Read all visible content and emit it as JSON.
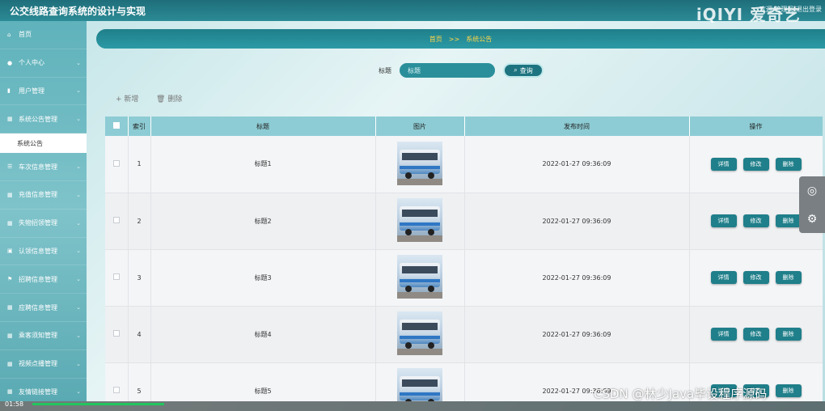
{
  "app": {
    "title": "公交线路查询系统的设计与实现",
    "top_right": "欢迎 管理员 退出登录",
    "brand_watermark": "iQIYI 爱奇艺"
  },
  "sidebar": {
    "items": [
      {
        "label": "首页",
        "icon": "home-icon",
        "glyph": "⌂"
      },
      {
        "label": "个人中心",
        "icon": "user-icon",
        "glyph": "●"
      },
      {
        "label": "用户管理",
        "icon": "bar-chart-icon",
        "glyph": "▮"
      },
      {
        "label": "系统公告管理",
        "icon": "grid-icon",
        "glyph": "▦"
      },
      {
        "label": "车次信息管理",
        "icon": "list-icon",
        "glyph": "☰"
      },
      {
        "label": "充值信息管理",
        "icon": "grid-icon",
        "glyph": "▦"
      },
      {
        "label": "失物招领管理",
        "icon": "grid-icon",
        "glyph": "▦"
      },
      {
        "label": "认领信息管理",
        "icon": "lock-icon",
        "glyph": "▣"
      },
      {
        "label": "招聘信息管理",
        "icon": "flag-icon",
        "glyph": "⚑"
      },
      {
        "label": "应聘信息管理",
        "icon": "grid-icon",
        "glyph": "▦"
      },
      {
        "label": "乘客须知管理",
        "icon": "grid-icon",
        "glyph": "▦"
      },
      {
        "label": "视频点播管理",
        "icon": "grid-icon",
        "glyph": "▦"
      },
      {
        "label": "友情链接管理",
        "icon": "grid-icon",
        "glyph": "▦"
      }
    ],
    "active_sub": "系统公告"
  },
  "breadcrumb": {
    "home": "首页",
    "sep": ">>",
    "current": "系统公告"
  },
  "search": {
    "label": "标题",
    "placeholder": "标题",
    "button": "查询",
    "button_icon": "search-icon"
  },
  "actions": {
    "add": "+ 新增",
    "delete": "删除",
    "delete_icon": "trash-icon"
  },
  "table": {
    "headers": [
      "",
      "索引",
      "标题",
      "图片",
      "发布时间",
      "操作"
    ],
    "rows": [
      {
        "index": "1",
        "title": "标题1",
        "time": "2022-01-27 09:36:09"
      },
      {
        "index": "2",
        "title": "标题2",
        "time": "2022-01-27 09:36:09"
      },
      {
        "index": "3",
        "title": "标题3",
        "time": "2022-01-27 09:36:09"
      },
      {
        "index": "4",
        "title": "标题4",
        "time": "2022-01-27 09:36:09"
      },
      {
        "index": "5",
        "title": "标题5",
        "time": "2022-01-27 09:36:09"
      }
    ],
    "ops": {
      "detail": "详情",
      "edit": "修改",
      "delete": "删除"
    }
  },
  "float_tools": {
    "camera_icon": "camera-icon",
    "settings_icon": "settings-icon"
  },
  "player": {
    "time": "01:58",
    "progress": 0.16,
    "progress_color": "#22c55e"
  },
  "watermark": "CSDN @林少Java毕设程序源码"
}
